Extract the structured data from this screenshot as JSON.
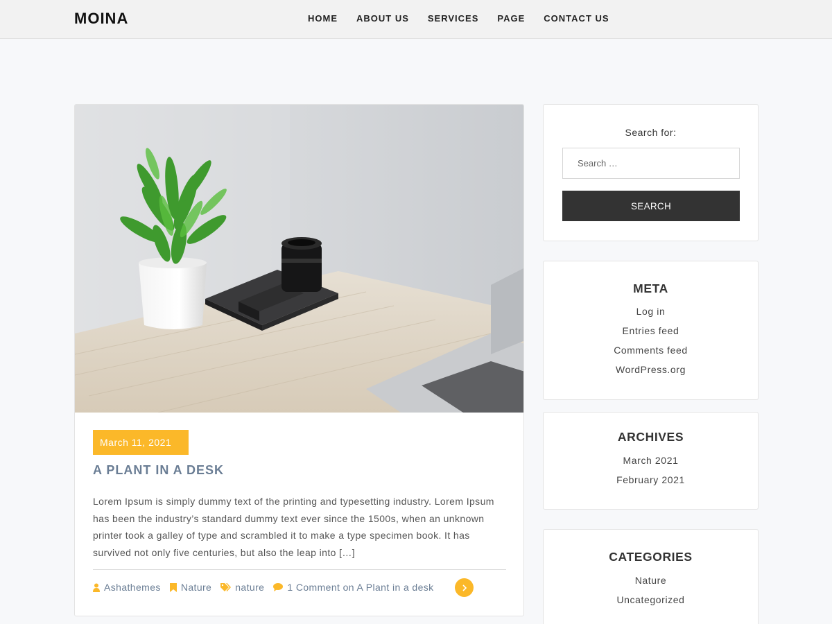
{
  "header": {
    "logo": "MOINA",
    "nav": [
      {
        "label": "HOME"
      },
      {
        "label": "ABOUT US"
      },
      {
        "label": "SERVICES"
      },
      {
        "label": "PAGE"
      },
      {
        "label": "CONTACT US"
      }
    ]
  },
  "post": {
    "date": "March 11, 2021",
    "title": "A PLANT IN A DESK",
    "excerpt": "Lorem Ipsum is simply dummy text of the printing and typesetting industry. Lorem Ipsum has been the industry’s standard dummy text ever since the 1500s, when an unknown printer took a galley of type and scrambled it to make a type specimen book. It has survived not only five centuries, but also the leap into […]",
    "meta": {
      "author": "Ashathemes",
      "category": "Nature",
      "tag": "nature",
      "comments": "1 Comment on A Plant in a desk"
    }
  },
  "sidebar": {
    "search": {
      "label": "Search for:",
      "placeholder": "Search …",
      "button": "SEARCH"
    },
    "meta": {
      "title": "META",
      "items": [
        "Log in",
        "Entries feed",
        "Comments feed",
        "WordPress.org"
      ]
    },
    "archives": {
      "title": "ARCHIVES",
      "items": [
        "March 2021",
        "February 2021"
      ]
    },
    "categories": {
      "title": "CATEGORIES",
      "items": [
        "Nature",
        "Uncategorized"
      ]
    }
  },
  "colors": {
    "accent": "#fbb829",
    "link": "#6a7d94",
    "dark_button": "#333333",
    "page_bg": "#f7f8fa"
  },
  "icons": [
    "user-icon",
    "bookmark-icon",
    "tags-icon",
    "comment-icon",
    "chevron-right-icon"
  ]
}
